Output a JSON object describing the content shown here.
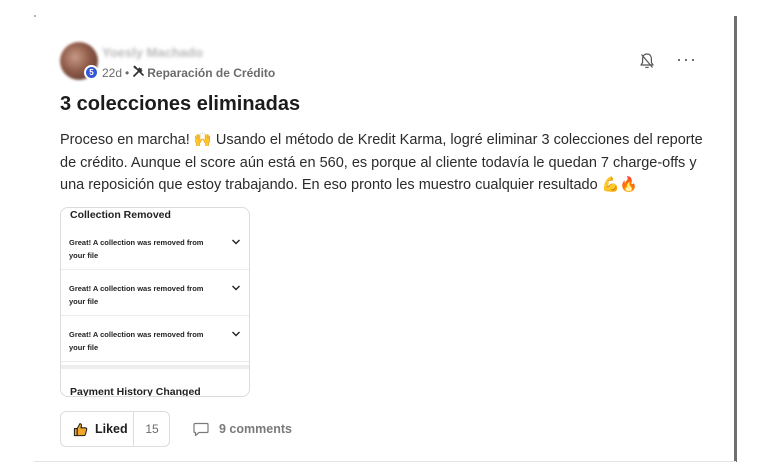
{
  "post": {
    "author": "Yoesly Machado",
    "time_ago": "22d",
    "separator": "•",
    "space_name": "Reparación de Crédito",
    "avatar_badge": "5",
    "title": "3 colecciones eliminadas",
    "body": "Proceso en marcha! 🙌 Usando el método de Kredit Karma, logré eliminar 3 colecciones del reporte de crédito. Aunque el score aún está en 560, es porque al cliente todavía le quedan 7 charge-offs y una reposición que estoy trabajando. En eso pronto les muestro cualquier resultado 💪🔥",
    "icons": [
      "bell-icon",
      "more-options-icon",
      "tools-icon",
      "thumbs-up-icon",
      "comment-icon",
      "chevron-down-icon"
    ]
  },
  "attachment": {
    "section_title": "Collection Removed",
    "rows": [
      {
        "text": "Great! A collection was removed from your file"
      },
      {
        "text": "Great! A collection was removed from your file"
      },
      {
        "text": "Great! A collection was removed from your file"
      }
    ],
    "next_section_title": "Payment History Changed"
  },
  "actions": {
    "like_label": "Liked",
    "like_count": "15",
    "comments_label": "9 comments"
  },
  "colors": {
    "text": "#1f1f1f",
    "muted": "#6b6b6b",
    "border": "#dddddd",
    "badge": "#3457d5"
  }
}
